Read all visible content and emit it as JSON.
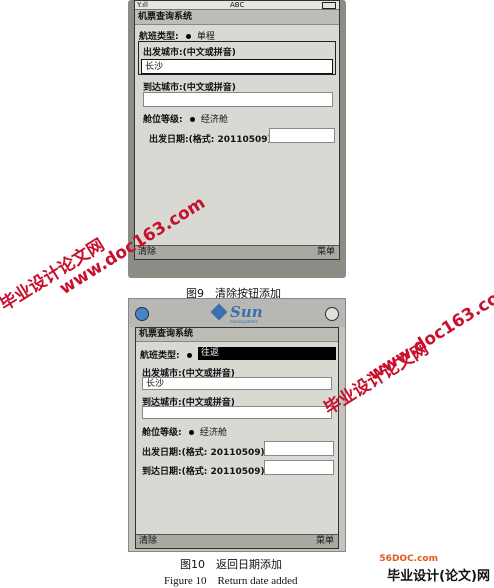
{
  "fig9": {
    "status": {
      "signal": "Y.ıll",
      "abc": "ABC"
    },
    "title": "机票查询系统",
    "flight_type_label": "航班类型:",
    "flight_type_value": "单程",
    "depart_label": "出发城市:(中文或拼音)",
    "depart_value": "长沙",
    "arrive_label": "到达城市:(中文或拼音)",
    "arrive_value": "",
    "cabin_label": "舱位等级:",
    "cabin_value": "经济舱",
    "date_label": "出发日期:(格式: 20110509)",
    "date_value": "",
    "softkey_left": "清除",
    "softkey_right": "菜单",
    "caption": "图9　清除按钮添加"
  },
  "fig10": {
    "brand": "Sun",
    "brand_sub": "microsystems",
    "title": "机票查询系统",
    "flight_type_label": "航班类型:",
    "flight_type_value": "往返",
    "depart_label": "出发城市:(中文或拼音)",
    "depart_value": "长沙",
    "arrive_label": "到达城市:(中文或拼音)",
    "arrive_value": "",
    "cabin_label": "舱位等级:",
    "cabin_value": "经济舱",
    "date_label": "出发日期:(格式: 20110509)",
    "date_value": "",
    "return_label": "到达日期:(格式: 20110509)",
    "return_value": "",
    "softkey_left": "清除",
    "softkey_right": "菜单",
    "caption": "图10　返回日期添加",
    "caption_en": "Figure 10　Return date added"
  },
  "watermarks": {
    "a1": "毕业设计论文网",
    "a2": "www.doc163.com",
    "b1": "毕业设计论文网",
    "b2": "www.doc163.com",
    "site": "56DOC.com",
    "badge": "毕业设计(论文)网"
  }
}
